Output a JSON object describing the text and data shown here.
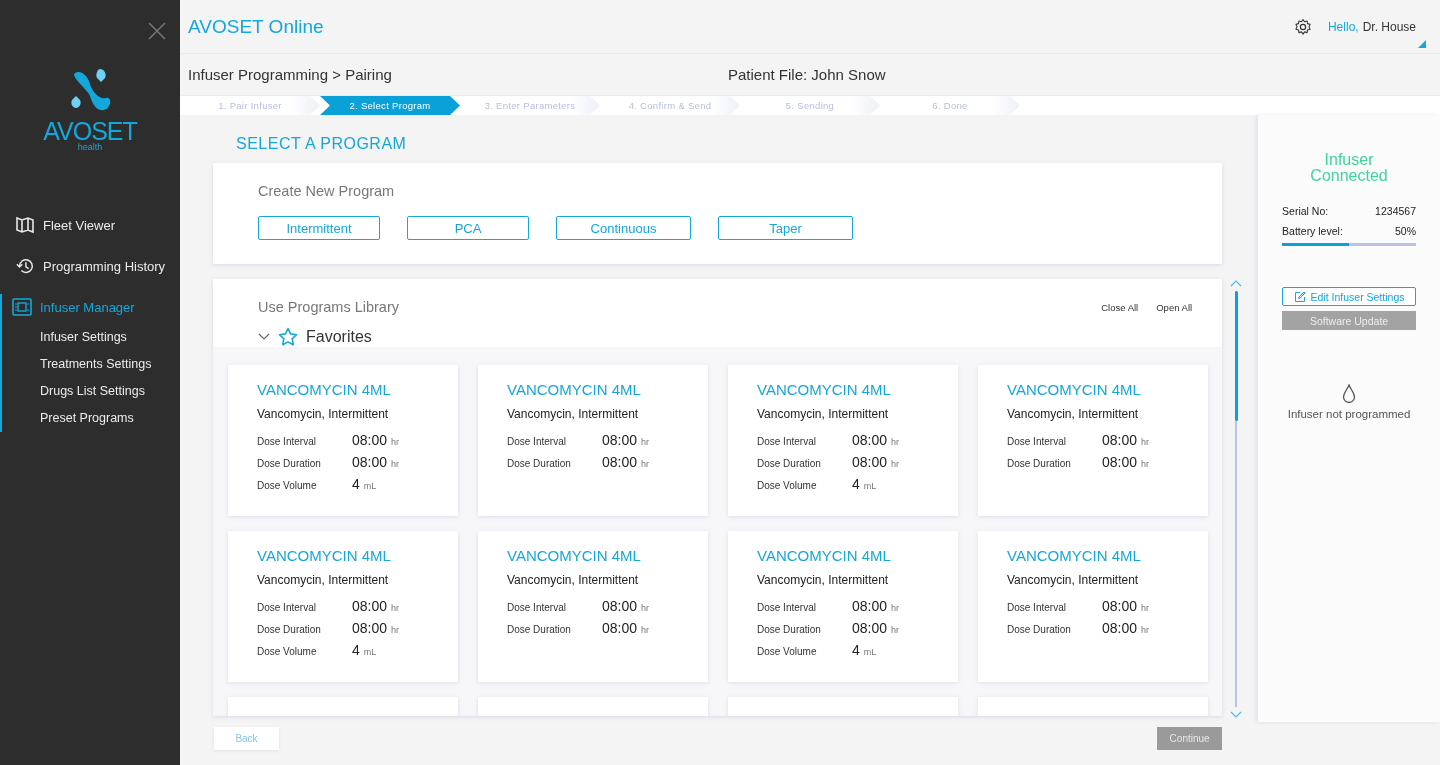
{
  "sidebar": {
    "brand": "AVOSET",
    "brand_sub": "health",
    "items": [
      {
        "label": "Fleet Viewer",
        "kind": "map",
        "selected": false
      },
      {
        "label": "Programming History",
        "kind": "history",
        "selected": false
      },
      {
        "label": "Infuser Manager",
        "kind": "device",
        "selected": true,
        "children": [
          {
            "label": "Infuser Settings"
          },
          {
            "label": "Treatments Settings"
          },
          {
            "label": "Drugs List Settings"
          },
          {
            "label": "Preset Programs"
          }
        ]
      }
    ]
  },
  "header": {
    "title": "AVOSET Online",
    "greeting": "Hello,",
    "user": "Dr. House"
  },
  "breadcrumb": "Infuser Programming > Pairing",
  "patient_file": "Patient File: John Snow",
  "steps": [
    {
      "label": "1. Pair Infuser",
      "selected": false
    },
    {
      "label": "2. Select Program",
      "selected": true
    },
    {
      "label": "3. Enter Parameters",
      "selected": false
    },
    {
      "label": "4. Confirm & Send",
      "selected": false
    },
    {
      "label": "5. Sending",
      "selected": false
    },
    {
      "label": "6. Done",
      "selected": false
    }
  ],
  "heading": "SELECT A PROGRAM",
  "create": {
    "title": "Create New Program",
    "buttons": [
      "Intermittent",
      "PCA",
      "Continuous",
      "Taper"
    ]
  },
  "library": {
    "title": "Use Programs Library",
    "close_all": "Close All",
    "open_all": "Open All",
    "group": "Favorites",
    "expanded": true,
    "cards": [
      {
        "title": "VANCOMYCIN 4ML",
        "subtitle": "Vancomycin, Intermittent",
        "rows": [
          {
            "label": "Dose Interval",
            "value": "08:00",
            "unit": "hr"
          },
          {
            "label": "Dose Duration",
            "value": "08:00",
            "unit": "hr"
          },
          {
            "label": "Dose Volume",
            "value": "4",
            "unit": "mL"
          }
        ]
      },
      {
        "title": "VANCOMYCIN 4ML",
        "subtitle": "Vancomycin, Intermittent",
        "rows": [
          {
            "label": "Dose Interval",
            "value": "08:00",
            "unit": "hr"
          },
          {
            "label": "Dose Duration",
            "value": "08:00",
            "unit": "hr"
          }
        ]
      },
      {
        "title": "VANCOMYCIN 4ML",
        "subtitle": "Vancomycin, Intermittent",
        "rows": [
          {
            "label": "Dose Interval",
            "value": "08:00",
            "unit": "hr"
          },
          {
            "label": "Dose Duration",
            "value": "08:00",
            "unit": "hr"
          },
          {
            "label": "Dose Volume",
            "value": "4",
            "unit": "mL"
          }
        ]
      },
      {
        "title": "VANCOMYCIN 4ML",
        "subtitle": "Vancomycin, Intermittent",
        "rows": [
          {
            "label": "Dose Interval",
            "value": "08:00",
            "unit": "hr"
          },
          {
            "label": "Dose Duration",
            "value": "08:00",
            "unit": "hr"
          }
        ]
      },
      {
        "title": "VANCOMYCIN 4ML",
        "subtitle": "Vancomycin, Intermittent",
        "rows": [
          {
            "label": "Dose Interval",
            "value": "08:00",
            "unit": "hr"
          },
          {
            "label": "Dose Duration",
            "value": "08:00",
            "unit": "hr"
          },
          {
            "label": "Dose Volume",
            "value": "4",
            "unit": "mL"
          }
        ]
      },
      {
        "title": "VANCOMYCIN 4ML",
        "subtitle": "Vancomycin, Intermittent",
        "rows": [
          {
            "label": "Dose Interval",
            "value": "08:00",
            "unit": "hr"
          },
          {
            "label": "Dose Duration",
            "value": "08:00",
            "unit": "hr"
          }
        ]
      },
      {
        "title": "VANCOMYCIN 4ML",
        "subtitle": "Vancomycin, Intermittent",
        "rows": [
          {
            "label": "Dose Interval",
            "value": "08:00",
            "unit": "hr"
          },
          {
            "label": "Dose Duration",
            "value": "08:00",
            "unit": "hr"
          },
          {
            "label": "Dose Volume",
            "value": "4",
            "unit": "mL"
          }
        ]
      },
      {
        "title": "VANCOMYCIN 4ML",
        "subtitle": "Vancomycin, Intermittent",
        "rows": [
          {
            "label": "Dose Interval",
            "value": "08:00",
            "unit": "hr"
          },
          {
            "label": "Dose Duration",
            "value": "08:00",
            "unit": "hr"
          }
        ]
      }
    ]
  },
  "footer": {
    "back": "Back",
    "continue": "Continue",
    "continue_disabled": true
  },
  "infuser": {
    "status": "Infuser Connected",
    "serial_label": "Serial No:",
    "serial": "1234567",
    "battery_label": "Battery level:",
    "battery": "50%",
    "level": 0.5,
    "edit": "Edit Infuser Settings",
    "update": "Software Update",
    "update_disabled": true,
    "program_status": "Infuser not programmed"
  }
}
